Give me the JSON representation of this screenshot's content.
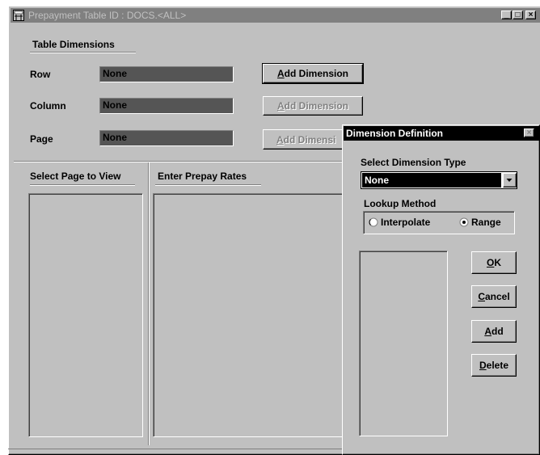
{
  "main_window": {
    "title": "Prepayment Table ID : DOCS.<ALL>",
    "controls": {
      "minimize": "_",
      "maximize": "□",
      "close": "×"
    }
  },
  "table_dimensions": {
    "heading": "Table Dimensions",
    "rows": [
      {
        "label": "Row",
        "value": "None",
        "button": "Add Dimension",
        "button_accel": "A",
        "button_rest": "dd Dimension"
      },
      {
        "label": "Column",
        "value": "None",
        "button": "Add Dimension",
        "button_accel": "A",
        "button_rest": "dd Dimension"
      },
      {
        "label": "Page",
        "value": "None",
        "button": "Add Dimensi",
        "button_accel": "A",
        "button_rest": "dd Dimensi"
      }
    ]
  },
  "select_page": {
    "heading": "Select Page to View"
  },
  "prepay_rates": {
    "heading": "Enter Prepay Rates"
  },
  "dialog": {
    "title": "Dimension Definition",
    "close": "×",
    "select_type_label": "Select Dimension Type",
    "dimension_type": "None",
    "lookup_label": "Lookup Method",
    "radio_interpolate": "Interpolate",
    "radio_range": "Range",
    "selected_radio": "Range",
    "ok_accel": "O",
    "ok_rest": "K",
    "cancel_accel": "C",
    "cancel_rest": "ancel",
    "add_accel": "A",
    "add_rest": "dd",
    "delete_accel": "D",
    "delete_rest": "elete"
  },
  "colors": {
    "face": "#c0c0c0",
    "title_active": "#000000",
    "title_inactive": "#808080",
    "field_dark": "#555555"
  }
}
